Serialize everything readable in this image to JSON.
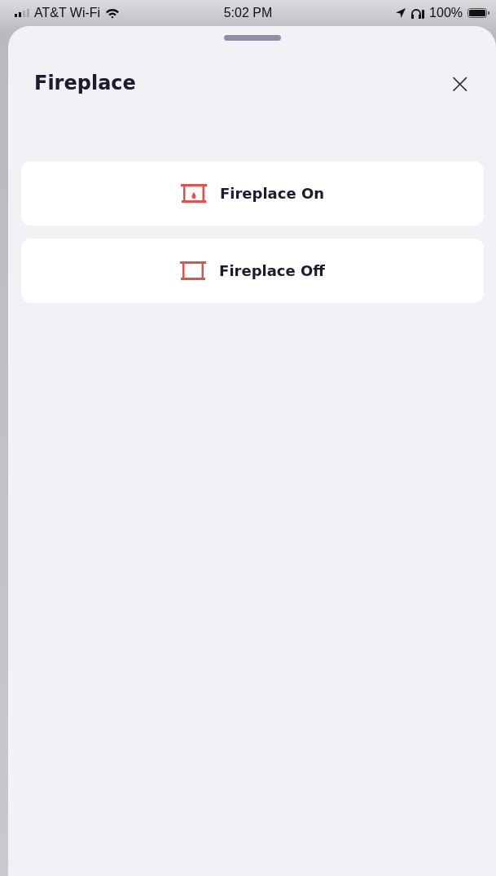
{
  "status_bar": {
    "carrier": "AT&T Wi-Fi",
    "time": "5:02 PM",
    "battery": "100%"
  },
  "sheet": {
    "title": "Fireplace",
    "close": "×"
  },
  "actions": [
    {
      "kind": "on",
      "label": "Fireplace On"
    },
    {
      "kind": "off",
      "label": "Fireplace Off"
    }
  ]
}
